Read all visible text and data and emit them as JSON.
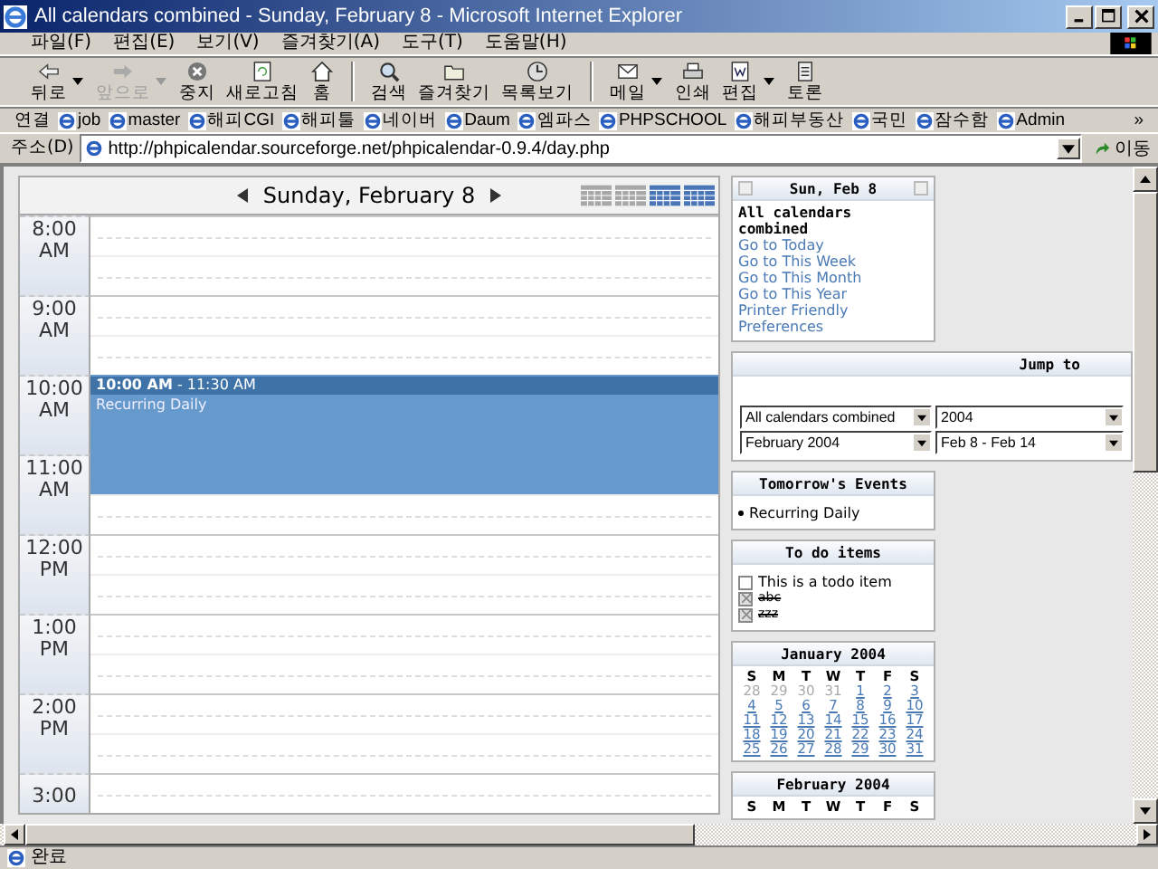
{
  "window": {
    "title": "All calendars combined - Sunday, February 8 - Microsoft Internet Explorer"
  },
  "menu": [
    "파일(F)",
    "편집(E)",
    "보기(V)",
    "즐겨찾기(A)",
    "도구(T)",
    "도움말(H)"
  ],
  "toolbar": [
    {
      "label": "뒤로",
      "kind": "back",
      "dropdown": true,
      "disabled": false
    },
    {
      "label": "앞으로",
      "kind": "forward",
      "dropdown": true,
      "disabled": true
    },
    {
      "label": "중지",
      "kind": "stop",
      "dropdown": false,
      "disabled": false
    },
    {
      "label": "새로고침",
      "kind": "refresh",
      "dropdown": false,
      "disabled": false
    },
    {
      "label": "홈",
      "kind": "home",
      "dropdown": false,
      "disabled": false
    },
    {
      "label": "검색",
      "kind": "search",
      "dropdown": false,
      "disabled": false
    },
    {
      "label": "즐겨찾기",
      "kind": "favorites",
      "dropdown": false,
      "disabled": false
    },
    {
      "label": "목록보기",
      "kind": "history",
      "dropdown": false,
      "disabled": false
    },
    {
      "label": "메일",
      "kind": "mail",
      "dropdown": true,
      "disabled": false
    },
    {
      "label": "인쇄",
      "kind": "print",
      "dropdown": false,
      "disabled": false
    },
    {
      "label": "편집",
      "kind": "edit",
      "dropdown": true,
      "disabled": false
    },
    {
      "label": "토론",
      "kind": "discuss",
      "dropdown": false,
      "disabled": false
    }
  ],
  "links": {
    "label": "연결",
    "items": [
      "job",
      "master",
      "해피CGI",
      "해피툴",
      "네이버",
      "Daum",
      "엠파스",
      "PHPSCHOOL",
      "해피부동산",
      "국민",
      "잠수함",
      "Admin"
    ],
    "more": "»"
  },
  "address": {
    "label": "주소(D)",
    "url": "http://phpicalendar.sourceforge.net/phpicalendar-0.9.4/day.php",
    "go": "이동"
  },
  "day_view": {
    "title": "Sunday, February 8",
    "hours": [
      {
        "time": "8:00",
        "period": "AM",
        "half_hours": [
          {
            "booked": false
          },
          {
            "booked": false
          }
        ]
      },
      {
        "time": "9:00",
        "period": "AM",
        "half_hours": [
          {
            "booked": false
          },
          {
            "booked": false
          }
        ]
      },
      {
        "time": "10:00",
        "period": "AM",
        "half_hours": [
          {
            "booked": true
          },
          {
            "booked": true
          }
        ]
      },
      {
        "time": "11:00",
        "period": "AM",
        "half_hours": [
          {
            "booked": true
          },
          {
            "booked": false
          }
        ]
      },
      {
        "time": "12:00",
        "period": "PM",
        "half_hours": [
          {
            "booked": false
          },
          {
            "booked": false
          }
        ]
      },
      {
        "time": "1:00",
        "period": "PM",
        "half_hours": [
          {
            "booked": false
          },
          {
            "booked": false
          }
        ]
      },
      {
        "time": "2:00",
        "period": "PM",
        "half_hours": [
          {
            "booked": false
          },
          {
            "booked": false
          }
        ]
      },
      {
        "time": "3:00",
        "half_hours": [
          {
            "booked": false
          }
        ]
      }
    ],
    "event": {
      "time": "**10:00 AM** - 11:30 AM",
      "title": "Recurring Daily"
    }
  },
  "sidebar": {
    "today": {
      "title": "Sun, Feb 8",
      "calendar": "All calendars combined",
      "links": [
        "Go to Today",
        "Go to This Week",
        "Go to This Month",
        "Go to This Year",
        "Printer Friendly",
        "Preferences"
      ]
    },
    "jump_to": {
      "title": "Jump to",
      "selects": [
        "All calendars combined",
        "2004",
        "February 2004",
        "Feb 8 - Feb 14"
      ]
    },
    "tomorrow": {
      "title": "Tomorrow's Events",
      "items": [
        "Recurring Daily"
      ]
    },
    "todo": {
      "title": "To do items",
      "items": [
        {
          "text": "This is a todo item",
          "done": false
        },
        {
          "text": "abc",
          "done": true
        },
        {
          "text": "zzz",
          "done": true
        }
      ]
    },
    "months": [
      {
        "title": "January 2004",
        "weekdays": [
          "S",
          "M",
          "T",
          "W",
          "T",
          "F",
          "S"
        ],
        "days": [
          {
            "day": "28",
            "other_month": true
          },
          {
            "day": "29",
            "other_month": true
          },
          {
            "day": "30",
            "other_month": true
          },
          {
            "day": "31",
            "other_month": true
          },
          {
            "day": "1",
            "other_month": false
          },
          {
            "day": "2",
            "other_month": false
          },
          {
            "day": "3",
            "other_month": false
          },
          {
            "day": "4",
            "other_month": false
          },
          {
            "day": "5",
            "other_month": false
          },
          {
            "day": "6",
            "other_month": false
          },
          {
            "day": "7",
            "other_month": false
          },
          {
            "day": "8",
            "other_month": false
          },
          {
            "day": "9",
            "other_month": false
          },
          {
            "day": "10",
            "other_month": false
          },
          {
            "day": "11",
            "other_month": false
          },
          {
            "day": "12",
            "other_month": false
          },
          {
            "day": "13",
            "other_month": false
          },
          {
            "day": "14",
            "other_month": false
          },
          {
            "day": "15",
            "other_month": false
          },
          {
            "day": "16",
            "other_month": false
          },
          {
            "day": "17",
            "other_month": false
          },
          {
            "day": "18",
            "other_month": false
          },
          {
            "day": "19",
            "other_month": false
          },
          {
            "day": "20",
            "other_month": false
          },
          {
            "day": "21",
            "other_month": false
          },
          {
            "day": "22",
            "other_month": false
          },
          {
            "day": "23",
            "other_month": false
          },
          {
            "day": "24",
            "other_month": false
          },
          {
            "day": "25",
            "other_month": false
          },
          {
            "day": "26",
            "other_month": false
          },
          {
            "day": "27",
            "other_month": false
          },
          {
            "day": "28",
            "other_month": false
          },
          {
            "day": "29",
            "other_month": false
          },
          {
            "day": "30",
            "other_month": false
          },
          {
            "day": "31",
            "other_month": false
          }
        ]
      },
      {
        "title": "February 2004",
        "weekdays": [
          "S",
          "M",
          "T",
          "W",
          "T",
          "F",
          "S"
        ]
      }
    ]
  },
  "status_bar": {
    "text": "완료"
  }
}
